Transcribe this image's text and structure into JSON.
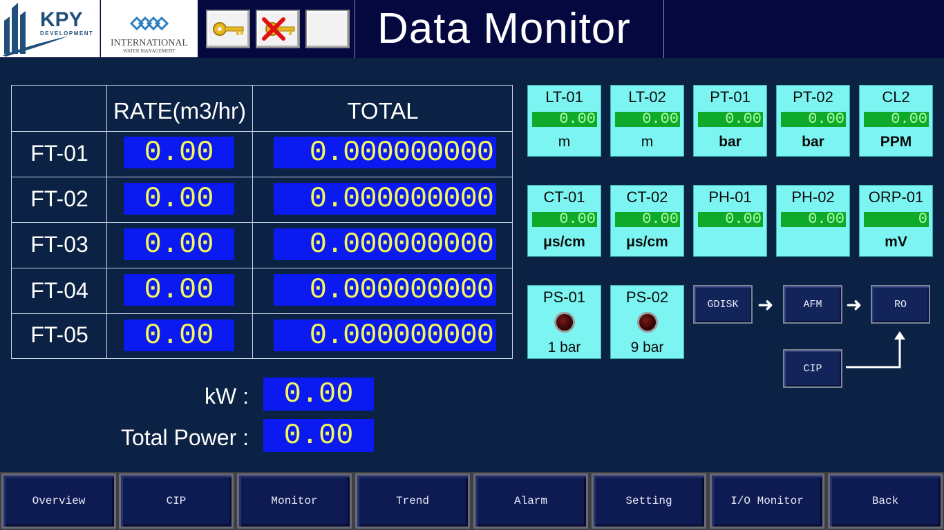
{
  "header": {
    "title": "Data Monitor",
    "logo_kpy": {
      "brand": "KPY",
      "sub": "DEVELOPMENT"
    },
    "logo_iwm": {
      "line1": "INTERNATIONAL",
      "line2": "WATER MANAGEMENT"
    }
  },
  "flow_table": {
    "col_rate": "RATE(m3/hr)",
    "col_total": "TOTAL",
    "rows": [
      {
        "label": "FT-01",
        "rate": "0.00",
        "total": "0.000000000"
      },
      {
        "label": "FT-02",
        "rate": "0.00",
        "total": "0.000000000"
      },
      {
        "label": "FT-03",
        "rate": "0.00",
        "total": "0.000000000"
      },
      {
        "label": "FT-04",
        "rate": "0.00",
        "total": "0.000000000"
      },
      {
        "label": "FT-05",
        "rate": "0.00",
        "total": "0.000000000"
      }
    ]
  },
  "power": {
    "kw_label": "kW :",
    "kw_value": "0.00",
    "total_label": "Total Power :",
    "total_value": "0.00"
  },
  "sensors": [
    {
      "name": "LT-01",
      "value": "0.00",
      "unit": "m"
    },
    {
      "name": "LT-02",
      "value": "0.00",
      "unit": "m"
    },
    {
      "name": "PT-01",
      "value": "0.00",
      "unit": "bar"
    },
    {
      "name": "PT-02",
      "value": "0.00",
      "unit": "bar"
    },
    {
      "name": "CL2",
      "value": "0.00",
      "unit": "PPM"
    },
    {
      "name": "CT-01",
      "value": "0.00",
      "unit": "μs/cm"
    },
    {
      "name": "CT-02",
      "value": "0.00",
      "unit": "μs/cm"
    },
    {
      "name": "PH-01",
      "value": "0.00",
      "unit": ""
    },
    {
      "name": "PH-02",
      "value": "0.00",
      "unit": ""
    },
    {
      "name": "ORP-01",
      "value": "0",
      "unit": "mV"
    }
  ],
  "switches": [
    {
      "name": "PS-01",
      "setting": "1 bar",
      "state": "off"
    },
    {
      "name": "PS-02",
      "setting": "9 bar",
      "state": "off"
    }
  ],
  "process": {
    "gdisk": "GDISK",
    "afm": "AFM",
    "ro": "RO",
    "cip": "CIP"
  },
  "nav": [
    "Overview",
    "CIP",
    "Monitor",
    "Trend",
    "Alarm",
    "Setting",
    "I/O Monitor",
    "Back"
  ],
  "colors": {
    "background": "#0b2244",
    "header": "#05083f",
    "lcd_bg": "#0a1af0",
    "lcd_text": "#f4f85a",
    "tile_bg": "#7cf5f2",
    "tile_value_bg": "#0faa2a"
  }
}
